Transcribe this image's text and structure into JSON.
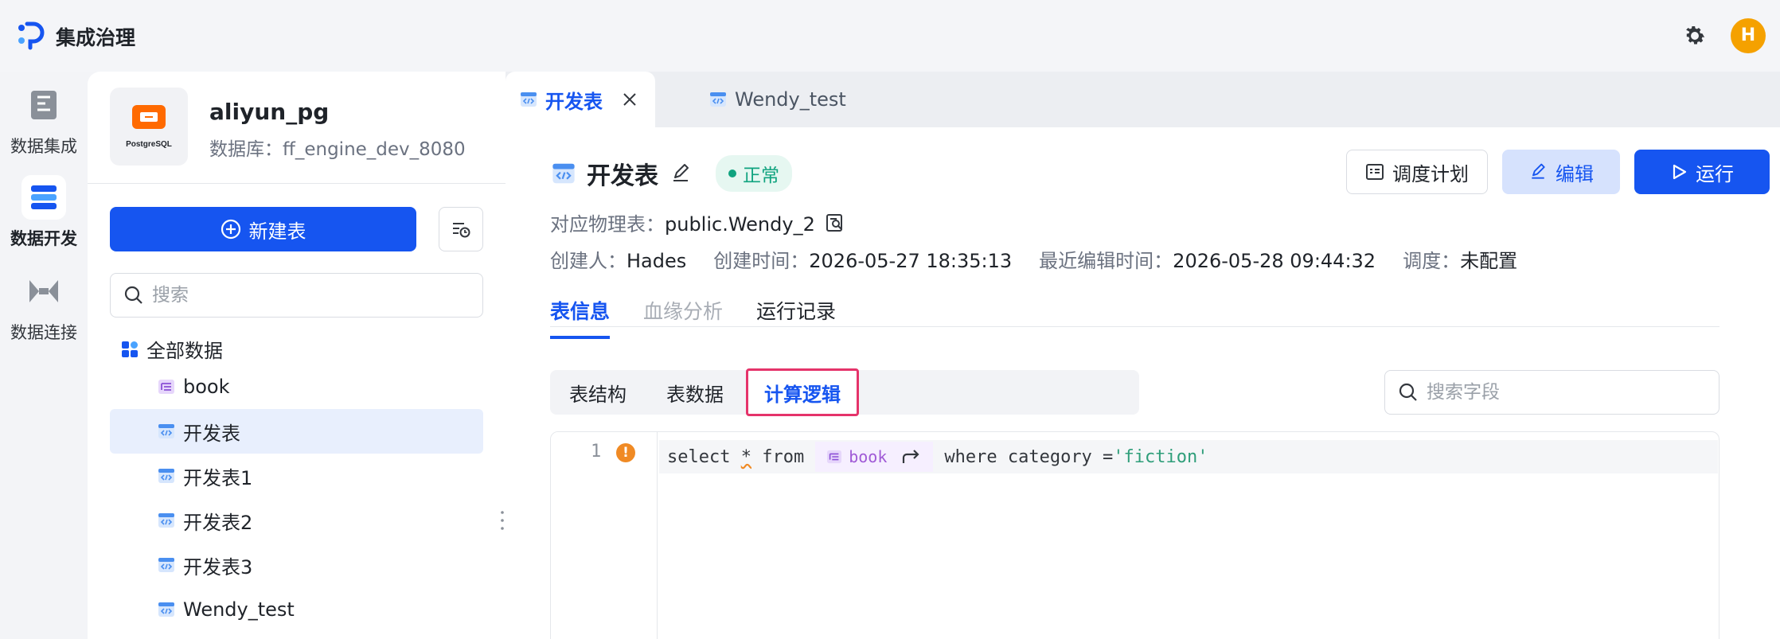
{
  "app": {
    "title": "集成治理",
    "avatar_initial": "H",
    "brand_color": "#1655f0"
  },
  "leftnav": {
    "items": [
      {
        "label": "数据集成",
        "icon": "integration-icon",
        "active": false
      },
      {
        "label": "数据开发",
        "icon": "development-icon",
        "active": true
      },
      {
        "label": "数据连接",
        "icon": "connection-icon",
        "active": false
      }
    ]
  },
  "sidebar": {
    "db_logo_text": "PostgreSQL",
    "db_name": "aliyun_pg",
    "db_sub": "数据库：ff_engine_dev_8080",
    "new_table_label": "新建表",
    "search_placeholder": "搜索",
    "tree_root": "全部数据",
    "items": [
      {
        "label": "book",
        "type": "table"
      },
      {
        "label": "开发表",
        "type": "dev",
        "selected": true
      },
      {
        "label": "开发表1",
        "type": "dev"
      },
      {
        "label": "开发表2",
        "type": "dev"
      },
      {
        "label": "开发表3",
        "type": "dev"
      },
      {
        "label": "Wendy_test",
        "type": "dev"
      }
    ]
  },
  "tabs": [
    {
      "label": "开发表",
      "active": true
    },
    {
      "label": "Wendy_test",
      "active": false
    }
  ],
  "detail": {
    "title": "开发表",
    "status": "正常",
    "schedule_label": "调度计划",
    "edit_label": "编辑",
    "run_label": "运行",
    "physical_label": "对应物理表：",
    "physical_value": "public.Wendy_2",
    "creator_label": "创建人：",
    "creator_value": "Hades",
    "created_label": "创建时间：",
    "created_value": "2026-05-27 18:35:13",
    "edited_label": "最近编辑时间：",
    "edited_value": "2026-05-28 09:44:32",
    "schedule_meta_label": "调度：",
    "schedule_meta_value": "未配置"
  },
  "main_tabs": [
    {
      "label": "表信息",
      "active": true
    },
    {
      "label": "血缘分析",
      "dim": true
    },
    {
      "label": "运行记录"
    }
  ],
  "sub_tabs": [
    {
      "label": "表结构"
    },
    {
      "label": "表数据"
    },
    {
      "label": "计算逻辑",
      "active": true
    }
  ],
  "field_search_placeholder": "搜索字段",
  "editor": {
    "line_number": "1",
    "warn_mark": "!",
    "code_select": "select ",
    "code_star": "*",
    "code_from": " from",
    "table_chip": "book",
    "code_where": "where category =",
    "code_string": "'fiction'"
  }
}
